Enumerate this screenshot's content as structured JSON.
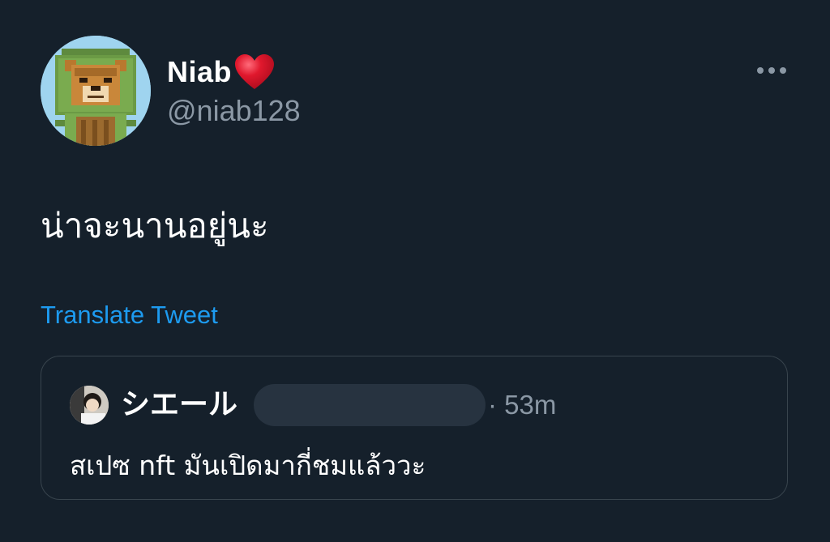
{
  "tweet": {
    "author": {
      "display_name": "Niab",
      "name_emoji": "heart-icon",
      "handle": "@niab128",
      "avatar": "pixel-lion-avatar"
    },
    "more_icon": "more-horizontal-icon",
    "text": "น่าจะนานอยู่นะ",
    "translate_label": "Translate Tweet"
  },
  "quoted_tweet": {
    "author": {
      "display_name": "シエール",
      "avatar": "user-avatar"
    },
    "separator": "·",
    "time": "53m",
    "text": "สเปซ nft มันเปิดมากี่ชมแล้ววะ"
  },
  "colors": {
    "background": "#15202b",
    "primary_text": "#ffffff",
    "secondary_text": "#8b98a5",
    "link": "#1d9bf0",
    "border": "#38444d",
    "heart": "#e0182d"
  }
}
